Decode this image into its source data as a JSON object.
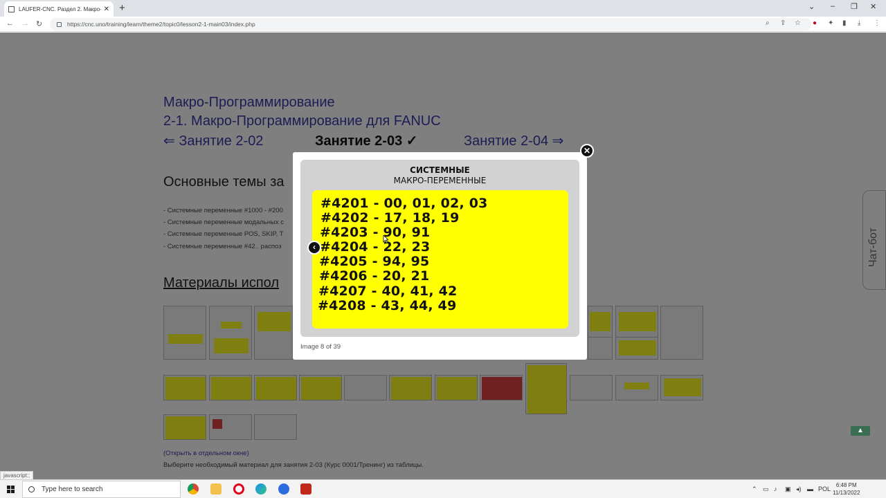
{
  "browser": {
    "tab_title": "LAUFER-CNC. Раздел 2. Макро-П",
    "url": "https://cnc.uno/training/learn/theme2/topic0/lesson2-1-main03/index.php",
    "status_url": "javascript:;"
  },
  "page": {
    "course_title": "Макро-Программирование",
    "lesson_group": "2-1. Макро-Программирование для FANUC",
    "prev_lesson": "⇐  Занятие 2-02",
    "current_lesson": "Занятие 2-03 ✓",
    "next_lesson": "Занятие 2-04  ⇒",
    "topics_heading": "Основные темы за",
    "topics": [
      "- Системные переменные #1000 - #200",
      "- Системные переменные модальных с",
      "- Системные переменные POS, SKIP, T",
      "- Системные переменные #42.. распоз"
    ],
    "materials_heading": "Материалы испол",
    "open_link": "(Открыть в отдельном окне)",
    "note": "Выберите необходимый материал для занятия 2-03 (Курс 0001/Тренинг) из таблицы.",
    "chatbot_label": "Чат-бот"
  },
  "lightbox": {
    "slide_title_line1": "СИСТЕМНЫЕ",
    "slide_title_line2": "МАКРО-ПЕРЕМЕННЫЕ",
    "lines": [
      "#4201 - 00, 01, 02, 03",
      "#4202 - 17, 18, 19",
      "#4203 - 90, 91",
      "#4204 - 22, 23",
      "#4205 - 94, 95",
      "#4206 - 20, 21",
      "#4207 - 40, 41, 42",
      "#4208 - 43, 44, 49"
    ],
    "caption": "Image 8 of 39"
  },
  "taskbar": {
    "search_placeholder": "Type here to search",
    "lang": "POL",
    "time": "6:48 PM",
    "date": "11/13/2022"
  },
  "colors": {
    "link": "#3a3aa8",
    "slide_yellow": "#ffff00",
    "slide_grey": "#d2d2d2",
    "overlay": "rgba(0,0,0,0.5)"
  }
}
